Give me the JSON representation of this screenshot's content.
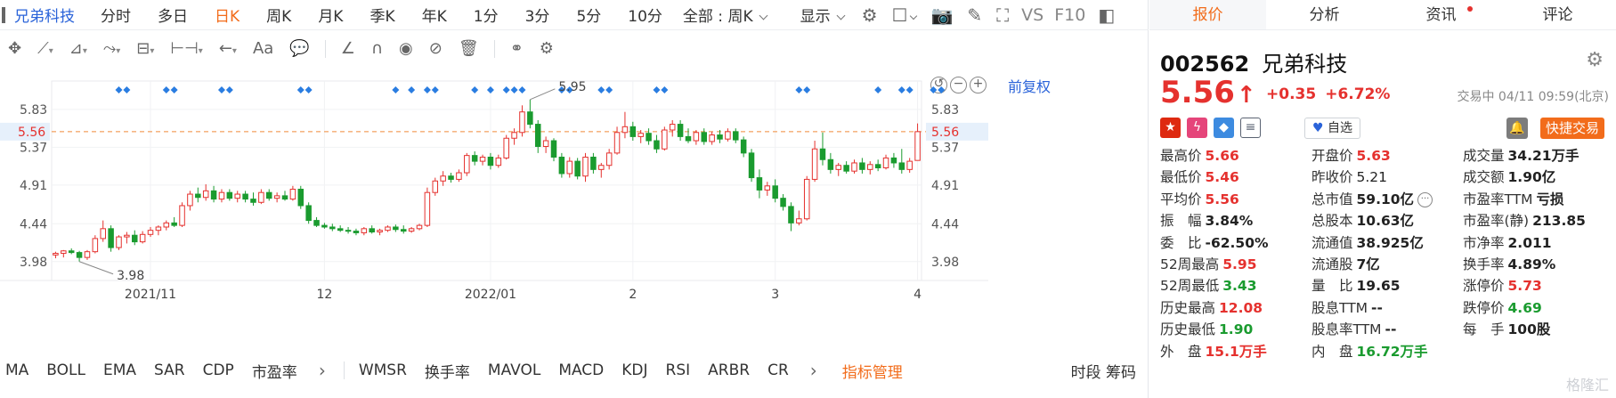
{
  "period_bar": {
    "stock_name": "兄弟科技",
    "periods": [
      "分时",
      "多日",
      "日K",
      "周K",
      "月K",
      "季K",
      "年K",
      "1分",
      "3分",
      "5分",
      "10分"
    ],
    "active_period": "日K",
    "scope_select": "全部 : 周K",
    "display_select": "显示",
    "vs_label": "VS",
    "f10_label": "F10"
  },
  "chart": {
    "restore_label": "前复权",
    "price_ticks": [
      "5.83",
      "5.37",
      "4.91",
      "4.44",
      "3.98"
    ],
    "current_price_label": "5.56",
    "date_ticks": [
      "2021/11",
      "12",
      "2022/01",
      "2",
      "3",
      "4"
    ],
    "high_annotation": "5.95",
    "low_annotation": "3.98"
  },
  "chart_data": {
    "type": "candlestick",
    "title": "",
    "xlabel": "",
    "ylabel": "",
    "ylim": [
      3.75,
      6.1
    ],
    "y_ticks": [
      5.83,
      5.37,
      4.91,
      4.44,
      3.98
    ],
    "x_tick_labels": [
      "2021/11",
      "12",
      "2022/01",
      "2",
      "3",
      "4"
    ],
    "current_price_line": 5.56,
    "high_label": 5.95,
    "low_label": 3.98,
    "up_color": "#e5312e",
    "down_color": "#1a9b2f",
    "candles": [
      {
        "o": 4.06,
        "h": 4.1,
        "l": 4.02,
        "c": 4.08
      },
      {
        "o": 4.08,
        "h": 4.12,
        "l": 4.03,
        "c": 4.11
      },
      {
        "o": 4.11,
        "h": 4.14,
        "l": 4.07,
        "c": 4.09
      },
      {
        "o": 4.09,
        "h": 4.11,
        "l": 3.98,
        "c": 4.03
      },
      {
        "o": 4.03,
        "h": 4.12,
        "l": 4.0,
        "c": 4.1
      },
      {
        "o": 4.1,
        "h": 4.3,
        "l": 4.08,
        "c": 4.26
      },
      {
        "o": 4.26,
        "h": 4.48,
        "l": 4.22,
        "c": 4.38
      },
      {
        "o": 4.38,
        "h": 4.42,
        "l": 4.1,
        "c": 4.15
      },
      {
        "o": 4.15,
        "h": 4.3,
        "l": 4.12,
        "c": 4.28
      },
      {
        "o": 4.28,
        "h": 4.34,
        "l": 4.2,
        "c": 4.3
      },
      {
        "o": 4.3,
        "h": 4.36,
        "l": 4.18,
        "c": 4.22
      },
      {
        "o": 4.22,
        "h": 4.35,
        "l": 4.2,
        "c": 4.31
      },
      {
        "o": 4.31,
        "h": 4.4,
        "l": 4.28,
        "c": 4.36
      },
      {
        "o": 4.36,
        "h": 4.42,
        "l": 4.3,
        "c": 4.4
      },
      {
        "o": 4.4,
        "h": 4.48,
        "l": 4.36,
        "c": 4.45
      },
      {
        "o": 4.45,
        "h": 4.52,
        "l": 4.4,
        "c": 4.42
      },
      {
        "o": 4.42,
        "h": 4.7,
        "l": 4.4,
        "c": 4.66
      },
      {
        "o": 4.66,
        "h": 4.84,
        "l": 4.6,
        "c": 4.8
      },
      {
        "o": 4.8,
        "h": 4.88,
        "l": 4.7,
        "c": 4.76
      },
      {
        "o": 4.76,
        "h": 4.92,
        "l": 4.72,
        "c": 4.84
      },
      {
        "o": 4.84,
        "h": 4.9,
        "l": 4.7,
        "c": 4.74
      },
      {
        "o": 4.74,
        "h": 4.86,
        "l": 4.7,
        "c": 4.82
      },
      {
        "o": 4.82,
        "h": 4.86,
        "l": 4.72,
        "c": 4.75
      },
      {
        "o": 4.75,
        "h": 4.84,
        "l": 4.7,
        "c": 4.8
      },
      {
        "o": 4.8,
        "h": 4.84,
        "l": 4.7,
        "c": 4.74
      },
      {
        "o": 4.74,
        "h": 4.82,
        "l": 4.66,
        "c": 4.7
      },
      {
        "o": 4.7,
        "h": 4.86,
        "l": 4.68,
        "c": 4.82
      },
      {
        "o": 4.82,
        "h": 4.86,
        "l": 4.72,
        "c": 4.75
      },
      {
        "o": 4.75,
        "h": 4.82,
        "l": 4.7,
        "c": 4.78
      },
      {
        "o": 4.78,
        "h": 4.84,
        "l": 4.72,
        "c": 4.74
      },
      {
        "o": 4.74,
        "h": 4.9,
        "l": 4.72,
        "c": 4.86
      },
      {
        "o": 4.86,
        "h": 4.9,
        "l": 4.62,
        "c": 4.66
      },
      {
        "o": 4.66,
        "h": 4.7,
        "l": 4.44,
        "c": 4.48
      },
      {
        "o": 4.48,
        "h": 4.52,
        "l": 4.4,
        "c": 4.42
      },
      {
        "o": 4.42,
        "h": 4.45,
        "l": 4.38,
        "c": 4.4
      },
      {
        "o": 4.4,
        "h": 4.44,
        "l": 4.35,
        "c": 4.38
      },
      {
        "o": 4.38,
        "h": 4.42,
        "l": 4.34,
        "c": 4.36
      },
      {
        "o": 4.36,
        "h": 4.4,
        "l": 4.32,
        "c": 4.35
      },
      {
        "o": 4.35,
        "h": 4.38,
        "l": 4.3,
        "c": 4.33
      },
      {
        "o": 4.33,
        "h": 4.4,
        "l": 4.3,
        "c": 4.38
      },
      {
        "o": 4.38,
        "h": 4.42,
        "l": 4.32,
        "c": 4.34
      },
      {
        "o": 4.34,
        "h": 4.38,
        "l": 4.3,
        "c": 4.36
      },
      {
        "o": 4.36,
        "h": 4.42,
        "l": 4.34,
        "c": 4.4
      },
      {
        "o": 4.4,
        "h": 4.43,
        "l": 4.34,
        "c": 4.37
      },
      {
        "o": 4.37,
        "h": 4.42,
        "l": 4.32,
        "c": 4.35
      },
      {
        "o": 4.35,
        "h": 4.4,
        "l": 4.33,
        "c": 4.38
      },
      {
        "o": 4.38,
        "h": 4.44,
        "l": 4.36,
        "c": 4.42
      },
      {
        "o": 4.42,
        "h": 4.88,
        "l": 4.4,
        "c": 4.82
      },
      {
        "o": 4.82,
        "h": 5.0,
        "l": 4.78,
        "c": 4.96
      },
      {
        "o": 4.96,
        "h": 5.08,
        "l": 4.9,
        "c": 5.02
      },
      {
        "o": 5.02,
        "h": 5.06,
        "l": 4.94,
        "c": 4.98
      },
      {
        "o": 4.98,
        "h": 5.1,
        "l": 4.95,
        "c": 5.06
      },
      {
        "o": 5.06,
        "h": 5.3,
        "l": 5.02,
        "c": 5.27
      },
      {
        "o": 5.27,
        "h": 5.32,
        "l": 5.15,
        "c": 5.2
      },
      {
        "o": 5.2,
        "h": 5.28,
        "l": 5.15,
        "c": 5.25
      },
      {
        "o": 5.25,
        "h": 5.3,
        "l": 5.1,
        "c": 5.15
      },
      {
        "o": 5.15,
        "h": 5.28,
        "l": 5.12,
        "c": 5.24
      },
      {
        "o": 5.24,
        "h": 5.52,
        "l": 5.22,
        "c": 5.48
      },
      {
        "o": 5.48,
        "h": 5.6,
        "l": 5.4,
        "c": 5.55
      },
      {
        "o": 5.55,
        "h": 5.88,
        "l": 5.5,
        "c": 5.8
      },
      {
        "o": 5.8,
        "h": 5.95,
        "l": 5.6,
        "c": 5.65
      },
      {
        "o": 5.65,
        "h": 5.7,
        "l": 5.3,
        "c": 5.38
      },
      {
        "o": 5.38,
        "h": 5.5,
        "l": 5.3,
        "c": 5.45
      },
      {
        "o": 5.45,
        "h": 5.48,
        "l": 5.2,
        "c": 5.25
      },
      {
        "o": 5.25,
        "h": 5.3,
        "l": 5.0,
        "c": 5.05
      },
      {
        "o": 5.05,
        "h": 5.25,
        "l": 5.0,
        "c": 5.2
      },
      {
        "o": 5.2,
        "h": 5.24,
        "l": 4.98,
        "c": 5.02
      },
      {
        "o": 5.02,
        "h": 5.3,
        "l": 4.95,
        "c": 5.25
      },
      {
        "o": 5.25,
        "h": 5.3,
        "l": 5.05,
        "c": 5.1
      },
      {
        "o": 5.1,
        "h": 5.18,
        "l": 5.0,
        "c": 5.15
      },
      {
        "o": 5.15,
        "h": 5.35,
        "l": 5.1,
        "c": 5.3
      },
      {
        "o": 5.3,
        "h": 5.62,
        "l": 5.28,
        "c": 5.55
      },
      {
        "o": 5.55,
        "h": 5.8,
        "l": 5.48,
        "c": 5.62
      },
      {
        "o": 5.62,
        "h": 5.68,
        "l": 5.45,
        "c": 5.5
      },
      {
        "o": 5.5,
        "h": 5.58,
        "l": 5.42,
        "c": 5.54
      },
      {
        "o": 5.54,
        "h": 5.6,
        "l": 5.4,
        "c": 5.45
      },
      {
        "o": 5.45,
        "h": 5.52,
        "l": 5.3,
        "c": 5.35
      },
      {
        "o": 5.35,
        "h": 5.62,
        "l": 5.33,
        "c": 5.58
      },
      {
        "o": 5.58,
        "h": 5.7,
        "l": 5.5,
        "c": 5.65
      },
      {
        "o": 5.65,
        "h": 5.7,
        "l": 5.45,
        "c": 5.5
      },
      {
        "o": 5.5,
        "h": 5.6,
        "l": 5.42,
        "c": 5.45
      },
      {
        "o": 5.45,
        "h": 5.58,
        "l": 5.4,
        "c": 5.55
      },
      {
        "o": 5.55,
        "h": 5.6,
        "l": 5.4,
        "c": 5.44
      },
      {
        "o": 5.44,
        "h": 5.56,
        "l": 5.4,
        "c": 5.52
      },
      {
        "o": 5.52,
        "h": 5.58,
        "l": 5.42,
        "c": 5.47
      },
      {
        "o": 5.47,
        "h": 5.6,
        "l": 5.44,
        "c": 5.56
      },
      {
        "o": 5.56,
        "h": 5.6,
        "l": 5.42,
        "c": 5.46
      },
      {
        "o": 5.46,
        "h": 5.5,
        "l": 5.25,
        "c": 5.3
      },
      {
        "o": 5.3,
        "h": 5.35,
        "l": 4.95,
        "c": 5.0
      },
      {
        "o": 5.0,
        "h": 5.1,
        "l": 4.75,
        "c": 4.85
      },
      {
        "o": 4.85,
        "h": 4.95,
        "l": 4.78,
        "c": 4.9
      },
      {
        "o": 4.9,
        "h": 4.98,
        "l": 4.7,
        "c": 4.75
      },
      {
        "o": 4.75,
        "h": 4.8,
        "l": 4.6,
        "c": 4.65
      },
      {
        "o": 4.65,
        "h": 4.7,
        "l": 4.35,
        "c": 4.45
      },
      {
        "o": 4.45,
        "h": 4.6,
        "l": 4.42,
        "c": 4.5
      },
      {
        "o": 4.5,
        "h": 5.02,
        "l": 4.48,
        "c": 4.98
      },
      {
        "o": 4.98,
        "h": 5.45,
        "l": 4.95,
        "c": 5.35
      },
      {
        "o": 5.35,
        "h": 5.55,
        "l": 5.15,
        "c": 5.22
      },
      {
        "o": 5.22,
        "h": 5.3,
        "l": 5.05,
        "c": 5.1
      },
      {
        "o": 5.1,
        "h": 5.18,
        "l": 5.02,
        "c": 5.15
      },
      {
        "o": 5.15,
        "h": 5.2,
        "l": 5.05,
        "c": 5.08
      },
      {
        "o": 5.08,
        "h": 5.22,
        "l": 5.05,
        "c": 5.18
      },
      {
        "o": 5.18,
        "h": 5.24,
        "l": 5.05,
        "c": 5.1
      },
      {
        "o": 5.1,
        "h": 5.2,
        "l": 5.04,
        "c": 5.16
      },
      {
        "o": 5.16,
        "h": 5.22,
        "l": 5.08,
        "c": 5.12
      },
      {
        "o": 5.12,
        "h": 5.28,
        "l": 5.1,
        "c": 5.24
      },
      {
        "o": 5.24,
        "h": 5.3,
        "l": 5.12,
        "c": 5.18
      },
      {
        "o": 5.18,
        "h": 5.35,
        "l": 5.05,
        "c": 5.1
      },
      {
        "o": 5.1,
        "h": 5.24,
        "l": 5.06,
        "c": 5.2
      },
      {
        "o": 5.21,
        "h": 5.66,
        "l": 5.46,
        "c": 5.56
      }
    ],
    "events_at_candle_index": [
      8,
      9,
      14,
      15,
      21,
      22,
      31,
      32,
      43,
      45,
      47,
      48,
      53,
      55,
      57,
      58,
      59,
      64,
      65,
      69,
      70,
      76,
      77,
      94,
      95,
      104,
      107,
      108,
      111,
      112
    ],
    "event_color": "#2a7de1"
  },
  "indicator_bar": {
    "group1": [
      "MA",
      "BOLL",
      "EMA",
      "SAR",
      "CDP",
      "市盈率"
    ],
    "group2": [
      "WMSR",
      "换手率",
      "MAVOL",
      "MACD",
      "KDJ",
      "RSI",
      "ARBR",
      "CR"
    ],
    "manager_label": "指标管理",
    "right_label": "时段 筹码"
  },
  "quote": {
    "tabs": [
      "报价",
      "分析",
      "资讯",
      "评论"
    ],
    "active_tab": "报价",
    "code": "002562",
    "name": "兄弟科技",
    "price": "5.56",
    "change": "+0.35",
    "change_pct": "+6.72%",
    "trade_time": "交易中 04/11 09:59(北京)",
    "watch_label": "自选",
    "quick_trade_label": "快捷交易",
    "stats": [
      [
        {
          "label": "最高价",
          "value": "5.66",
          "tone": "red"
        },
        {
          "label": "开盘价",
          "value": "5.63",
          "tone": "red"
        },
        {
          "label": "成交量",
          "value": "34.21万手",
          "tone": "black"
        }
      ],
      [
        {
          "label": "最低价",
          "value": "5.46",
          "tone": "red"
        },
        {
          "label": "昨收价",
          "value": "5.21",
          "tone": "plain"
        },
        {
          "label": "成交额",
          "value": "1.90亿",
          "tone": "black"
        }
      ],
      [
        {
          "label": "平均价",
          "value": "5.56",
          "tone": "red"
        },
        {
          "label": "总市值",
          "value": "59.10亿",
          "tone": "black"
        },
        {
          "label": "市盈率TTM",
          "value": "亏损",
          "tone": "black"
        }
      ],
      [
        {
          "label": "振　幅",
          "value": "3.84%",
          "tone": "black"
        },
        {
          "label": "总股本",
          "value": "10.63亿",
          "tone": "black"
        },
        {
          "label": "市盈率(静)",
          "value": "213.85",
          "tone": "black"
        }
      ],
      [
        {
          "label": "委　比",
          "value": "-62.50%",
          "tone": "black"
        },
        {
          "label": "流通值",
          "value": "38.925亿",
          "tone": "black"
        },
        {
          "label": "市净率",
          "value": "2.011",
          "tone": "black"
        }
      ],
      [
        {
          "label": "52周最高",
          "value": "5.95",
          "tone": "red"
        },
        {
          "label": "流通股",
          "value": "7亿",
          "tone": "black"
        },
        {
          "label": "换手率",
          "value": "4.89%",
          "tone": "black"
        }
      ],
      [
        {
          "label": "52周最低",
          "value": "3.43",
          "tone": "green"
        },
        {
          "label": "量　比",
          "value": "19.65",
          "tone": "black"
        },
        {
          "label": "涨停价",
          "value": "5.73",
          "tone": "red"
        }
      ],
      [
        {
          "label": "历史最高",
          "value": "12.08",
          "tone": "red"
        },
        {
          "label": "股息TTM",
          "value": "--",
          "tone": "black"
        },
        {
          "label": "跌停价",
          "value": "4.69",
          "tone": "green"
        }
      ],
      [
        {
          "label": "历史最低",
          "value": "1.90",
          "tone": "green"
        },
        {
          "label": "股息率TTM",
          "value": "--",
          "tone": "black"
        },
        {
          "label": "每　手",
          "value": "100股",
          "tone": "black"
        }
      ],
      [
        {
          "label": "外　盘",
          "value": "15.1万手",
          "tone": "red"
        },
        {
          "label": "内　盘",
          "value": "16.72万手",
          "tone": "green"
        },
        {
          "label": "",
          "value": "",
          "tone": "plain"
        }
      ]
    ]
  },
  "watermark": "格隆汇"
}
